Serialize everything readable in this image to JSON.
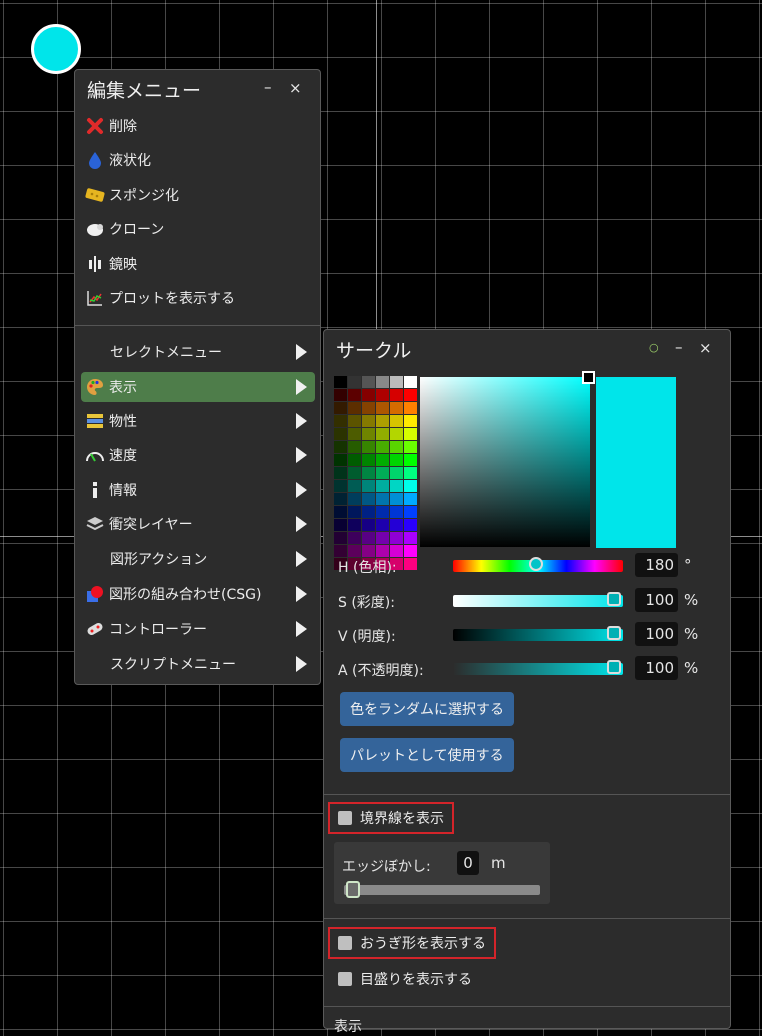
{
  "edit_menu": {
    "title": "編集メニュー",
    "minimize": "–",
    "close": "×",
    "items": [
      {
        "label": "削除",
        "icon": "delete-x-icon"
      },
      {
        "label": "液状化",
        "icon": "water-drop-icon"
      },
      {
        "label": "スポンジ化",
        "icon": "sponge-icon"
      },
      {
        "label": "クローン",
        "icon": "clone-sheep-icon"
      },
      {
        "label": "鏡映",
        "icon": "mirror-icon"
      },
      {
        "label": "プロットを表示する",
        "icon": "plot-icon"
      }
    ],
    "submenus": [
      {
        "label": "セレクトメニュー"
      },
      {
        "label": "表示",
        "icon": "palette-icon",
        "active": true
      },
      {
        "label": "物性",
        "icon": "material-icon"
      },
      {
        "label": "速度",
        "icon": "speedometer-icon"
      },
      {
        "label": "情報",
        "icon": "info-icon"
      },
      {
        "label": "衝突レイヤー",
        "icon": "layers-icon"
      },
      {
        "label": "図形アクション"
      },
      {
        "label": "図形の組み合わせ(CSG)",
        "icon": "csg-icon"
      },
      {
        "label": "コントローラー",
        "icon": "gamepad-icon"
      },
      {
        "label": "スクリプトメニュー"
      }
    ]
  },
  "appearance_panel": {
    "title": "サークル",
    "pin": "○",
    "minimize": "–",
    "close": "×",
    "preview_color": "#00e5ea",
    "hue": {
      "label": "H (色相):",
      "value": "180",
      "unit": "°",
      "fraction": 0.5
    },
    "saturation": {
      "label": "S (彩度):",
      "value": "100",
      "unit": "%",
      "fraction": 1.0
    },
    "value": {
      "label": "V (明度):",
      "value": "100",
      "unit": "%",
      "fraction": 1.0
    },
    "alpha": {
      "label": "A (不透明度):",
      "value": "100",
      "unit": "%",
      "fraction": 1.0
    },
    "random_color_button": "色をランダムに選択する",
    "use_as_palette_button": "パレットとして使用する",
    "show_outline": "境界線を表示",
    "edge_blur_label": "エッジぼかし:",
    "edge_blur_value": "0",
    "edge_blur_unit": "m",
    "show_protractor": "おうぎ形を表示する",
    "show_ticks": "目盛りを表示する",
    "cut_off_text": "表示"
  }
}
